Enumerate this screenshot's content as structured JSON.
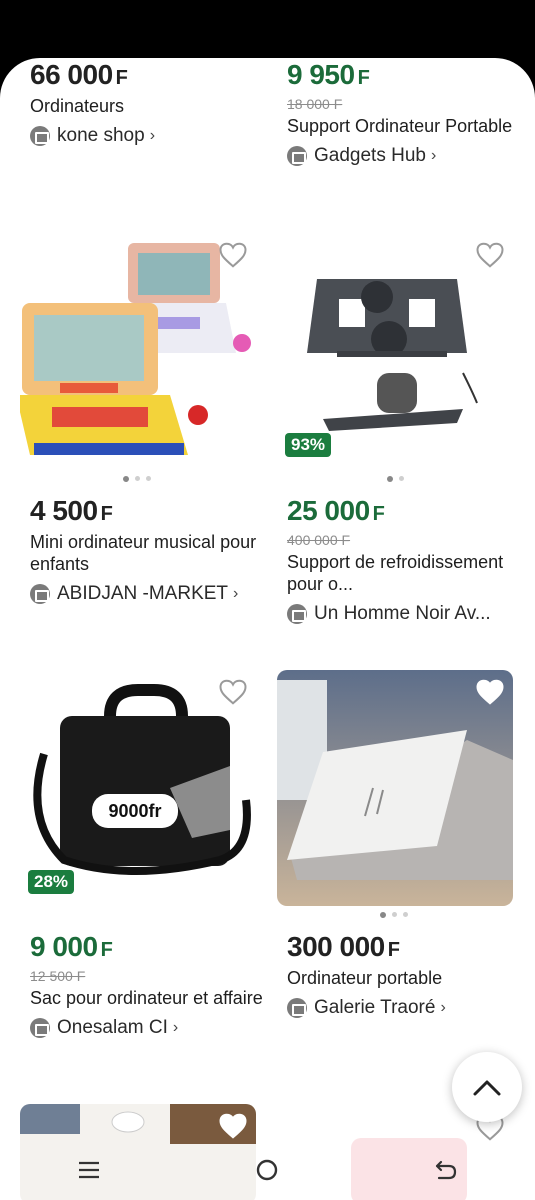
{
  "products": [
    {
      "price": "66 000",
      "currency": "F",
      "title": "Ordinateurs",
      "shop": "kone shop"
    },
    {
      "price": "9 950",
      "currency": "F",
      "old_price": "18 000 F",
      "title": "Support Ordinateur Portable",
      "shop": "Gadgets Hub"
    },
    {
      "price": "4 500",
      "currency": "F",
      "title": "Mini ordinateur musical pour enfants",
      "shop": "ABIDJAN -MARKET"
    },
    {
      "price": "25 000",
      "currency": "F",
      "old_price": "400 000 F",
      "discount": "93%",
      "title": "Support de refroidissement pour o...",
      "shop": "Un Homme Noir Av..."
    },
    {
      "price": "9 000",
      "currency": "F",
      "old_price": "12 500 F",
      "discount": "28%",
      "title": "Sac pour ordinateur et affaire",
      "shop": "Onesalam CI",
      "image_text": "9000fr"
    },
    {
      "price": "300 000",
      "currency": "F",
      "title": "Ordinateur portable",
      "shop": "Galerie Traoré"
    }
  ],
  "chevron": "›",
  "colors": {
    "accent_green": "#1b6b3a",
    "badge_green": "#1b7d3f"
  },
  "nav": {
    "menu_icon": "menu-icon",
    "home_icon": "home-icon",
    "back_icon": "back-icon"
  }
}
